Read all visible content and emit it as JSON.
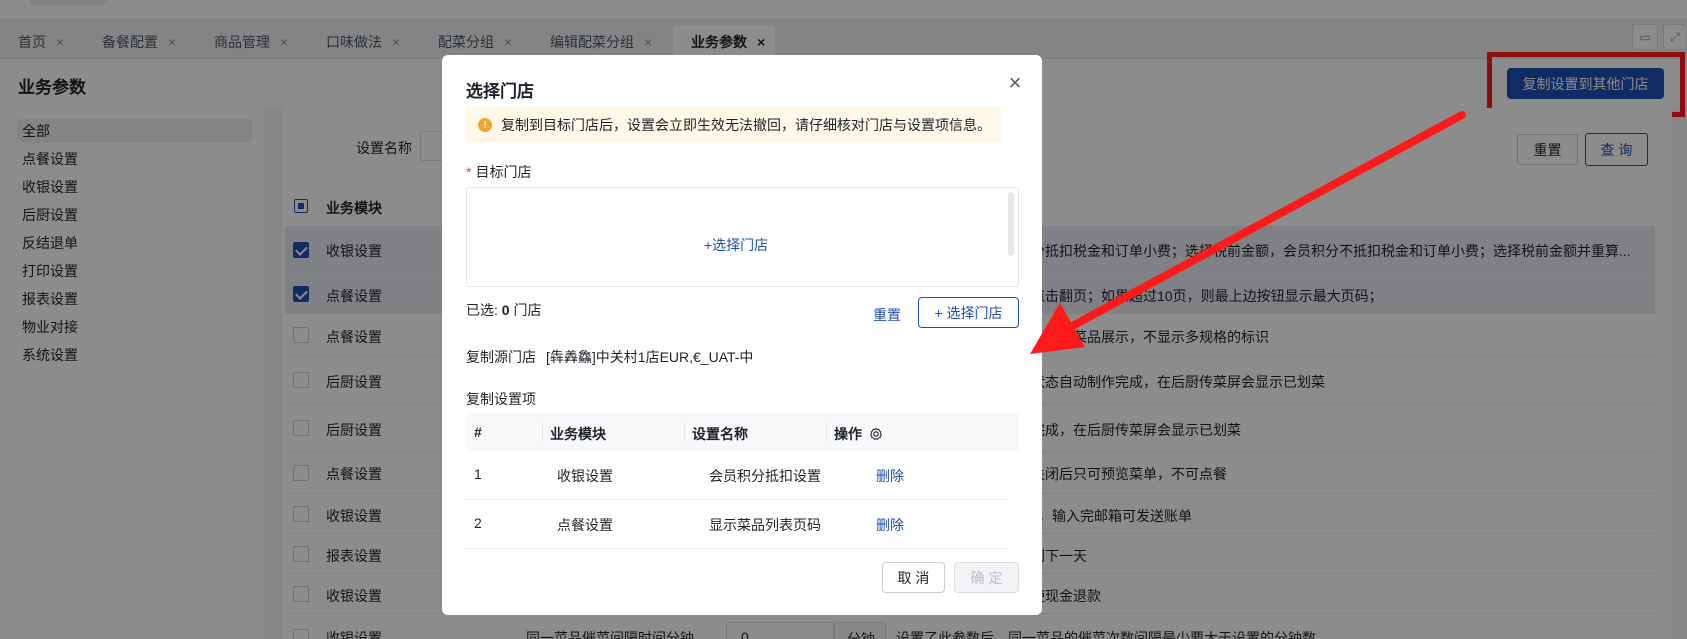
{
  "tabs": [
    {
      "label": "首页",
      "active": false
    },
    {
      "label": "备餐配置",
      "active": false
    },
    {
      "label": "商品管理",
      "active": false
    },
    {
      "label": "口味做法",
      "active": false
    },
    {
      "label": "配菜分组",
      "active": false
    },
    {
      "label": "编辑配菜分组",
      "active": false
    },
    {
      "label": "业务参数",
      "active": true
    }
  ],
  "tab_close_glyph": "×",
  "page": {
    "title": "业务参数",
    "copy_button": "复制设置到其他门店"
  },
  "sidebar": {
    "items": [
      "全部",
      "点餐设置",
      "收银设置",
      "后厨设置",
      "反结退单",
      "打印设置",
      "报表设置",
      "物业对接",
      "系统设置"
    ]
  },
  "filter": {
    "label": "设置名称",
    "reset": "重置",
    "query": "查 询"
  },
  "table": {
    "header_module": "业务模块",
    "rows": [
      {
        "module": "收银设置",
        "checked": true,
        "desc": "分抵扣税金和订单小费；选择税前金额，会员积分不抵扣税金和订单小费；选择税前金额并重算..."
      },
      {
        "module": "点餐设置",
        "checked": true,
        "desc": "点击翻页；如果超过10页，则最上边按钮显示最大页码；"
      },
      {
        "module": "点餐设置",
        "checked": false,
        "desc": "为多个菜品展示，不显示多规格的标识"
      },
      {
        "module": "后厨设置",
        "checked": false,
        "desc": "状态自动制作完成，在后厨传菜屏会显示已划菜"
      },
      {
        "module": "后厨设置",
        "checked": false,
        "desc": "完成，在后厨传菜屏会显示已划菜"
      },
      {
        "module": "点餐设置",
        "checked": false,
        "desc": "关闭后只可预览菜单，不可点餐"
      },
      {
        "module": "收银设置",
        "checked": false,
        "desc": "】，输入完邮箱可发送账单"
      },
      {
        "module": "报表设置",
        "checked": false,
        "desc": "到下一天"
      },
      {
        "module": "收银设置",
        "checked": false,
        "desc": "使现金退款"
      },
      {
        "module": "收银设置",
        "checked": false,
        "desc": ""
      }
    ],
    "partial_last_row": {
      "name": "同一菜品催菜间隔时间分钟",
      "input_value": "0",
      "unit": "分钟",
      "desc": "设置了此参数后，同一菜品的催菜次数间隔最少要大于设置的分钟数"
    }
  },
  "modal": {
    "title": "选择门店",
    "close_glyph": "×",
    "alert_icon": "!",
    "alert": "复制到目标门店后，设置会立即生效无法撤回，请仔细核对门店与设置项信息。",
    "target_label": "目标门店",
    "target_required_mark": "*",
    "select_store_link": "+选择门店",
    "selected_prefix": "已选: ",
    "selected_count": "0",
    "selected_suffix": " 门店",
    "reset": "重置",
    "choose_store_button": "+ 选择门店",
    "source_label": "复制源门店",
    "source_value": "[犇羴鱻]中关村1店EUR,€_UAT-中",
    "copy_items_label": "复制设置项",
    "columns": [
      "#",
      "业务模块",
      "设置名称",
      "操作"
    ],
    "rows": [
      {
        "index": "1",
        "module": "收银设置",
        "name": "会员积分抵扣设置",
        "action": "删除"
      },
      {
        "index": "2",
        "module": "点餐设置",
        "name": "显示菜品列表页码",
        "action": "删除"
      }
    ],
    "cancel": "取 消",
    "ok": "确 定"
  },
  "annotation": {
    "highlight_color": "#ff1a1a",
    "arrow_color": "#ff1a1a"
  },
  "colors": {
    "primary": "#1f4fb5",
    "warning": "#f7a531"
  }
}
